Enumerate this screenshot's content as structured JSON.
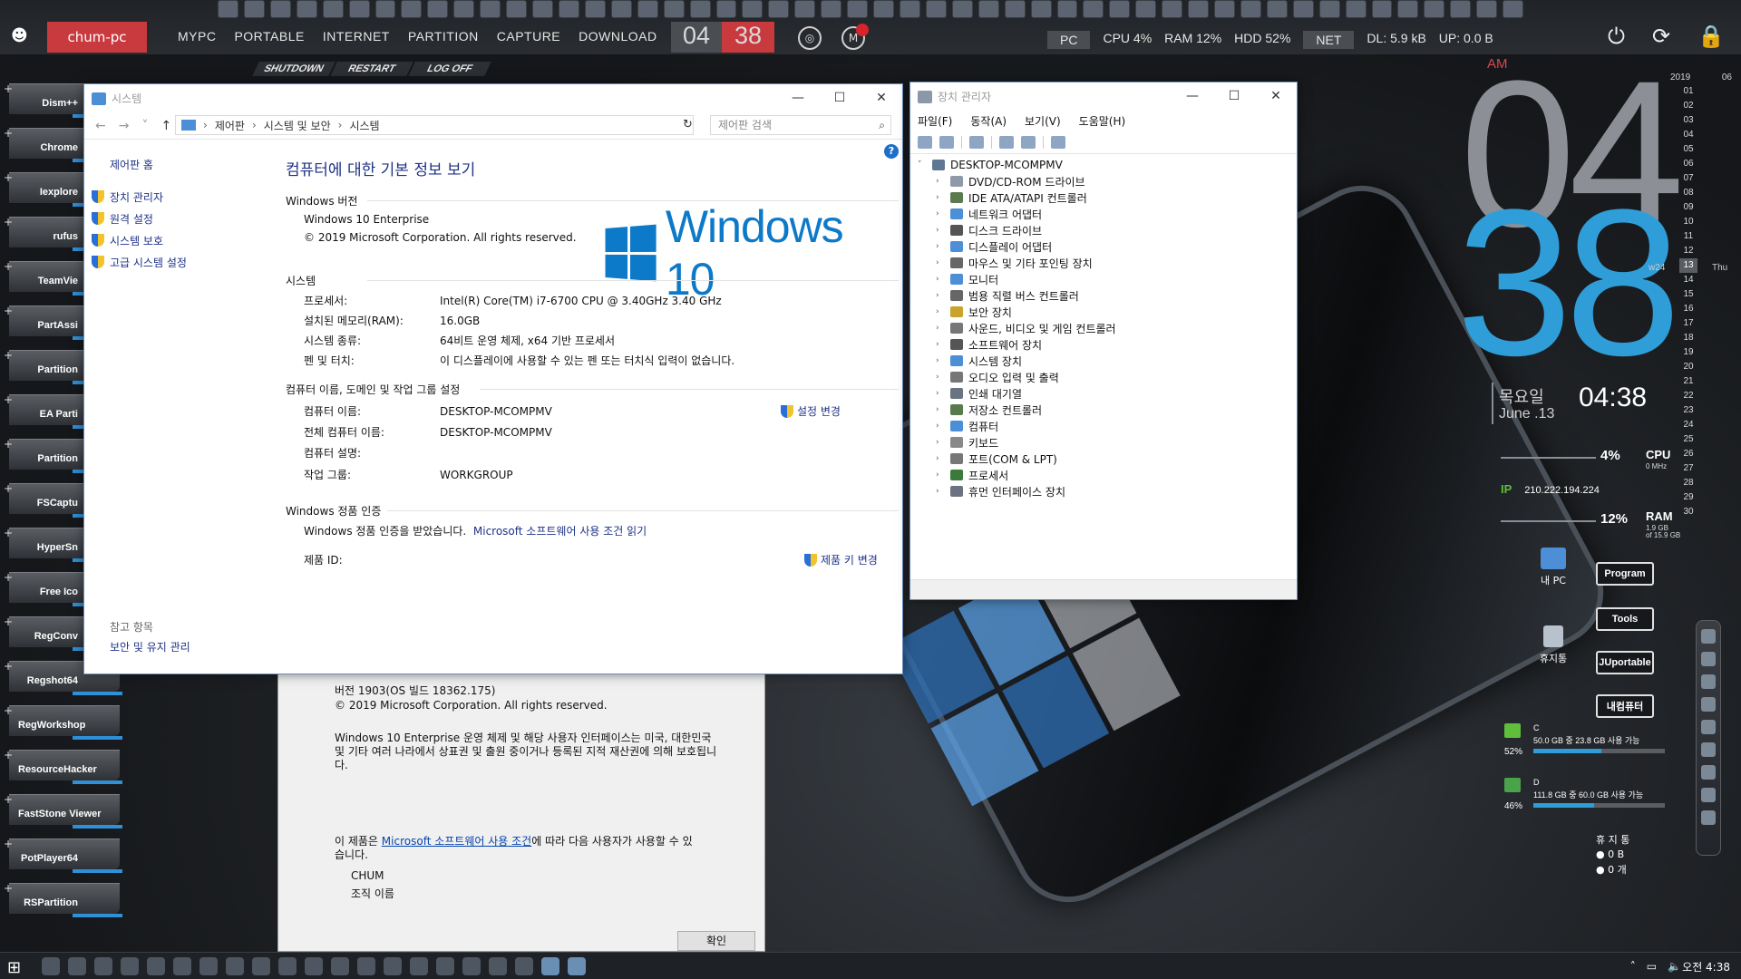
{
  "topbar": {
    "logo": "☻",
    "pc_name": "chum-pc",
    "menu": [
      "MYPC",
      "PORTABLE",
      "INTERNET",
      "PARTITION",
      "CAPTURE",
      "DOWNLOAD"
    ],
    "hour": "04",
    "minute": "38",
    "stats": {
      "pc_label": "PC",
      "cpu": "CPU  4%",
      "ram": "RAM  12%",
      "hdd": "HDD  52%",
      "net_label": "NET",
      "dl": "DL: 5.9 kB",
      "up": "UP: 0.0 B"
    },
    "sub_buttons": [
      "SHUTDOWN",
      "RESTART",
      "LOG OFF"
    ],
    "right_icons": [
      "power-icon",
      "refresh-icon",
      "lock-icon"
    ],
    "right_glyphs": [
      "⏻",
      "⟳",
      "🔒"
    ]
  },
  "dock": [
    "Dism++",
    "Chrome",
    "Iexplore",
    "rufus",
    "TeamVie",
    "PartAssi",
    "Partition",
    "EA Parti",
    "Partition",
    "FSCaptu",
    "HyperSn",
    "Free Ico",
    "RegConv",
    "Regshot64",
    "RegWorkshop",
    "ResourceHacker",
    "FastStone Viewer",
    "PotPlayer64",
    "RSPartition"
  ],
  "widget": {
    "ampm": "AM",
    "big_hour": "04",
    "big_minute": "38",
    "calendar_year": "2019",
    "calendar_month": "06",
    "calendar_days": [
      "01",
      "02",
      "03",
      "04",
      "05",
      "06",
      "07",
      "08",
      "09",
      "10",
      "11",
      "12",
      "13",
      "14",
      "15",
      "16",
      "17",
      "18",
      "19",
      "20",
      "21",
      "22",
      "23",
      "24",
      "25",
      "26",
      "27",
      "28",
      "29",
      "30"
    ],
    "today": "13",
    "week_label": "w24",
    "dow_label": "Thu",
    "weekday": "목요일",
    "date": "June .13",
    "time": "04:38",
    "cpu_pct": "4%",
    "cpu_label": "CPU",
    "cpu_sub": "0 MHz",
    "ip_label": "IP",
    "ip": "210.222.194.224",
    "ram_pct": "12%",
    "ram_label": "RAM",
    "ram_sub1": "1.9 GB",
    "ram_sub2": "of 15.9 GB",
    "launch_buttons": [
      "Program",
      "Tools",
      "JUportable",
      "내컴퓨터"
    ],
    "mypc_label": "내 PC",
    "recycle_label": "휴지통",
    "drives": [
      {
        "letter": "C",
        "info": "50.0 GB 중  23.8 GB 사용 가능",
        "pct": "52%",
        "fill": 0.52
      },
      {
        "letter": "D",
        "info": "111.8 GB 중 60.0 GB 사용 가능",
        "pct": "46%",
        "fill": 0.46
      }
    ],
    "recycle_title": "휴 지 통",
    "recycle_size": "0 B",
    "recycle_count": "0 개"
  },
  "about": {
    "version": "버전 1903(OS 빌드 18362.175)",
    "copyright": "© 2019 Microsoft Corporation. All rights reserved.",
    "paragraph": "Windows 10 Enterprise 운영 체제 및 해당 사용자 인터페이스는 미국, 대한민국 및 기타 여러 나라에서 상표권 및 출원 중이거나 등록된 지적 재산권에 의해 보호됩니다.",
    "license_prefix": "이 제품은 ",
    "license_link": "Microsoft 소프트웨어 사용 조건",
    "license_suffix": "에 따라 다음 사용자가 사용할 수 있습니다.",
    "user": "CHUM",
    "org": "조직 이름",
    "ok": "확인"
  },
  "system": {
    "title": "시스템",
    "breadcrumbs": [
      "제어판",
      "시스템 및 보안",
      "시스템"
    ],
    "search_placeholder": "제어판 검색",
    "left": {
      "home": "제어판 홈",
      "links": [
        "장치 관리자",
        "원격 설정",
        "시스템 보호",
        "고급 시스템 설정"
      ],
      "see_also": "참고 항목",
      "security": "보안 및 유지 관리"
    },
    "heading": "컴퓨터에 대한 기본 정보 보기",
    "edition_title": "Windows 버전",
    "edition": "Windows 10 Enterprise",
    "edition_copyright": "© 2019 Microsoft Corporation. All rights reserved.",
    "logo_text": "Windows 10",
    "system_title": "시스템",
    "processor_k": "프로세서:",
    "processor_v": "Intel(R) Core(TM) i7-6700 CPU @ 3.40GHz   3.40 GHz",
    "ram_k": "설치된 메모리(RAM):",
    "ram_v": "16.0GB",
    "type_k": "시스템 종류:",
    "type_v": "64비트 운영 체제, x64 기반 프로세서",
    "pen_k": "펜 및 터치:",
    "pen_v": "이 디스플레이에 사용할 수 있는 펜 또는 터치식 입력이 없습니다.",
    "name_title": "컴퓨터 이름, 도메인 및 작업 그룹 설정",
    "cname_k": "컴퓨터 이름:",
    "cname_v": "DESKTOP-MCOMPMV",
    "full_k": "전체 컴퓨터 이름:",
    "full_v": "DESKTOP-MCOMPMV",
    "desc_k": "컴퓨터 설명:",
    "desc_v": "",
    "wg_k": "작업 그룹:",
    "wg_v": "WORKGROUP",
    "change_settings": "설정 변경",
    "activation_title": "Windows 정품 인증",
    "activated": "Windows 정품 인증을 받았습니다.",
    "license_link": "Microsoft 소프트웨어 사용 조건 읽기",
    "product_k": "제품 ID:",
    "product_v": "",
    "change_key": "제품 키 변경"
  },
  "devmgr": {
    "title": "장치 관리자",
    "menu": [
      "파일(F)",
      "동작(A)",
      "보기(V)",
      "도움말(H)"
    ],
    "root": "DESKTOP-MCOMPMV",
    "nodes": [
      "DVD/CD-ROM 드라이브",
      "IDE ATA/ATAPI 컨트롤러",
      "네트워크 어댑터",
      "디스크 드라이브",
      "디스플레이 어댑터",
      "마우스 및 기타 포인팅 장치",
      "모니터",
      "범용 직렬 버스 컨트롤러",
      "보안 장치",
      "사운드, 비디오 및 게임 컨트롤러",
      "소프트웨어 장치",
      "시스템 장치",
      "오디오 입력 및 출력",
      "인쇄 대기열",
      "저장소 컨트롤러",
      "컴퓨터",
      "키보드",
      "포트(COM & LPT)",
      "프로세서",
      "휴먼 인터페이스 장치"
    ]
  },
  "taskbar": {
    "start": "⊞",
    "tray": [
      "˄",
      "▭",
      "🔈"
    ],
    "clock": "오전 4:38"
  },
  "colors": {
    "accent_red": "#c93a3f",
    "accent_blue": "#2f9ed8",
    "win_link": "#1e3287",
    "win_logo": "#0d79c9"
  }
}
